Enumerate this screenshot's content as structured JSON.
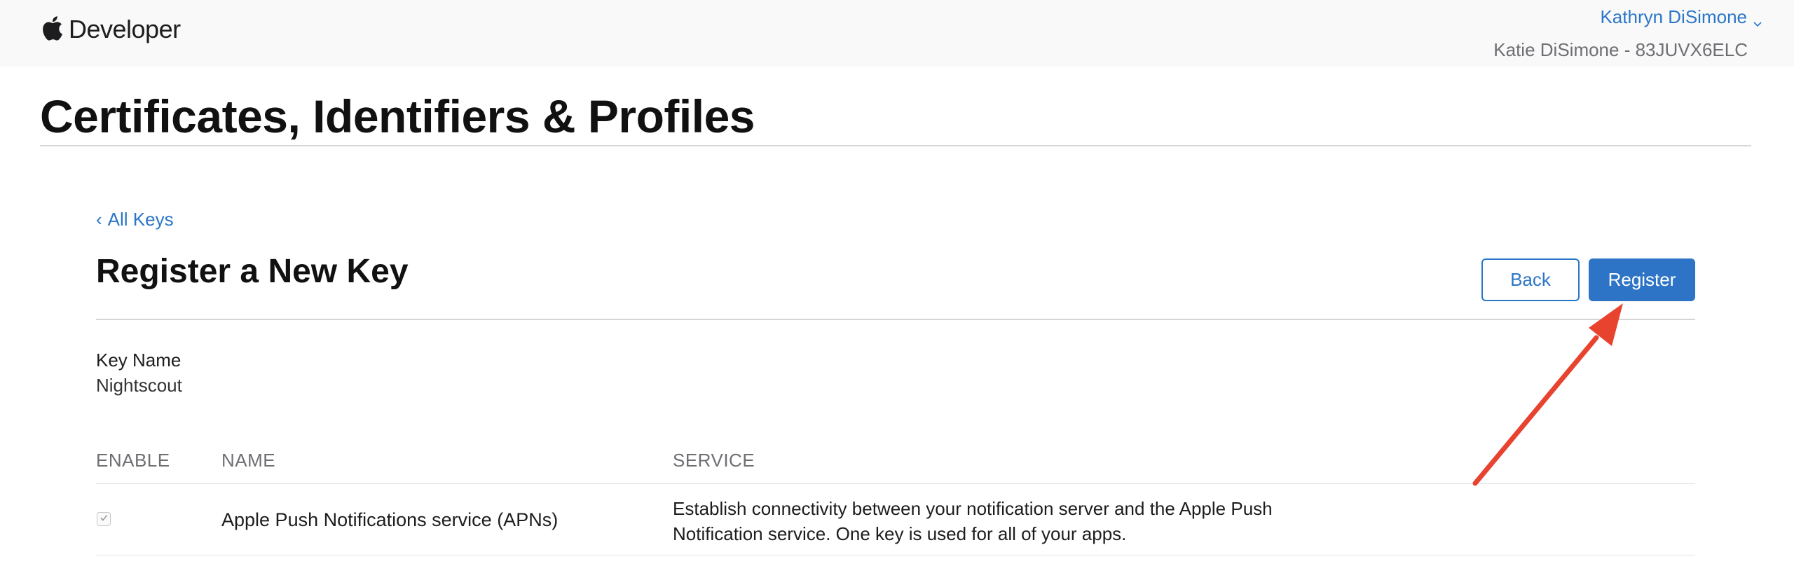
{
  "header": {
    "brand": "Developer",
    "account_name": "Kathryn DiSimone",
    "account_team": "Katie DiSimone - 83JUVX6ELC"
  },
  "page": {
    "title": "Certificates, Identifiers & Profiles"
  },
  "nav": {
    "back_link": "All Keys"
  },
  "section": {
    "title": "Register a New Key",
    "back_button": "Back",
    "register_button": "Register"
  },
  "key": {
    "name_label": "Key Name",
    "name_value": "Nightscout"
  },
  "table": {
    "columns": [
      "ENABLE",
      "NAME",
      "SERVICE"
    ],
    "rows": [
      {
        "enabled": true,
        "name": "Apple Push Notifications service (APNs)",
        "service": "Establish connectivity between your notification server and the Apple Push Notification service. One key is used for all of your apps."
      }
    ]
  },
  "colors": {
    "accent": "#2b76c8",
    "button_primary": "#2d74c6",
    "annotation_arrow": "#e8432f"
  },
  "icons": {
    "brand_logo": "apple-logo-icon",
    "account_menu": "chevron-down-icon",
    "back": "chevron-left-icon",
    "checkbox": "checkmark-icon"
  }
}
